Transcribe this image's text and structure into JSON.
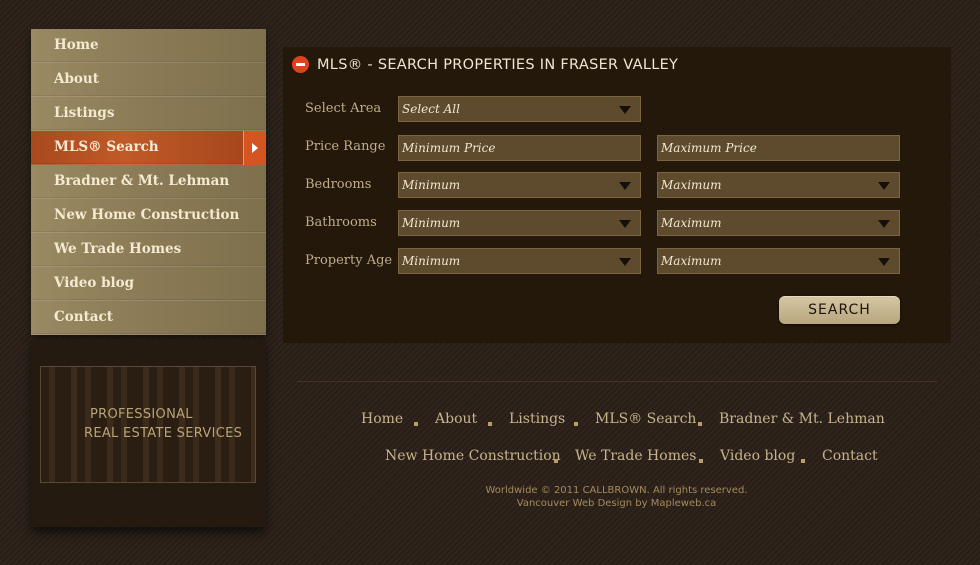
{
  "sidebar": {
    "items": [
      {
        "label": "Home"
      },
      {
        "label": "About"
      },
      {
        "label": "Listings"
      },
      {
        "label": "MLS® Search"
      },
      {
        "label": "Bradner & Mt. Lehman"
      },
      {
        "label": "New Home Construction"
      },
      {
        "label": "We Trade Homes"
      },
      {
        "label": "Video blog"
      },
      {
        "label": "Contact"
      }
    ],
    "active": "MLS® Search",
    "promo": {
      "line1": "PROFESSIONAL",
      "line2": "REAL ESTATE SERVICES"
    }
  },
  "search_panel": {
    "title": "MLS® - SEARCH PROPERTIES IN FRASER VALLEY",
    "rows": {
      "area": {
        "label": "Select Area",
        "value": "Select All"
      },
      "price": {
        "label": "Price Range",
        "min_placeholder": "Minimum Price",
        "max_placeholder": "Maximum Price"
      },
      "bedrooms": {
        "label": "Bedrooms",
        "min": "Minimum",
        "max": "Maximum"
      },
      "bathrooms": {
        "label": "Bathrooms",
        "min": "Minimum",
        "max": "Maximum"
      },
      "age": {
        "label": "Property Age",
        "min": "Minimum",
        "max": "Maximum"
      }
    },
    "button": "SEARCH"
  },
  "footer": {
    "links_row1": [
      "Home",
      "About",
      "Listings",
      "MLS® Search",
      "Bradner & Mt. Lehman"
    ],
    "links_row2": [
      "New Home Construction",
      "We Trade Homes",
      "Video blog",
      "Contact"
    ],
    "copyright": "Worldwide © 2011 CALLBROWN. All rights reserved.",
    "credit": "Vancouver Web Design by Mapleweb.ca"
  },
  "colors": {
    "accent": "#c05a28",
    "panel": "#231809",
    "field": "#5e4b2e"
  }
}
